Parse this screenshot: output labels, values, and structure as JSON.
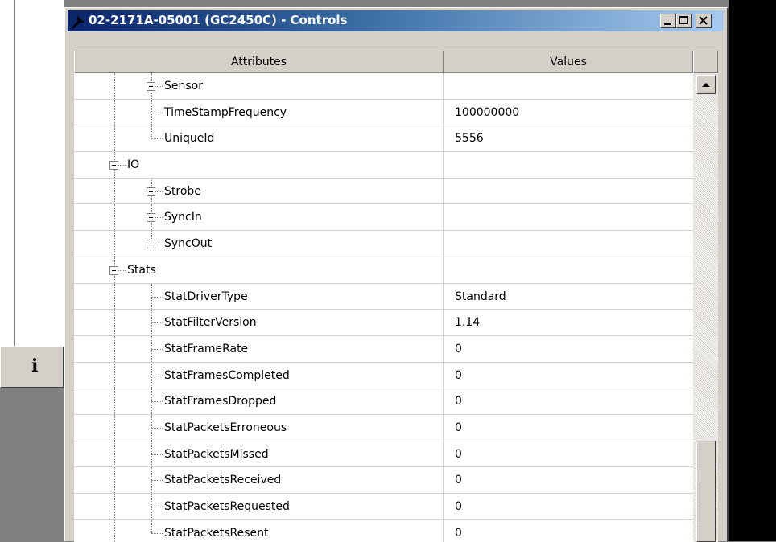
{
  "window": {
    "title": "02-2171A-05001 (GC2450C) - Controls",
    "title_icon": "wrench-icon",
    "buttons": {
      "minimize": "minimize-icon",
      "maximize": "maximize-icon",
      "close": "close-icon"
    }
  },
  "background": {
    "info_button": "i"
  },
  "grid": {
    "columns": [
      "Attributes",
      "Values"
    ],
    "rows": [
      {
        "label": "Sensor",
        "value": "",
        "level": 2,
        "expander": "plus"
      },
      {
        "label": "TimeStampFrequency",
        "value": "100000000",
        "level": 2,
        "expander": ""
      },
      {
        "label": "UniqueId",
        "value": "5556",
        "level": 2,
        "expander": "",
        "last": true
      },
      {
        "label": "IO",
        "value": "",
        "level": 1,
        "expander": "minus"
      },
      {
        "label": "Strobe",
        "value": "",
        "level": 2,
        "expander": "plus"
      },
      {
        "label": "SyncIn",
        "value": "",
        "level": 2,
        "expander": "plus"
      },
      {
        "label": "SyncOut",
        "value": "",
        "level": 2,
        "expander": "plus",
        "last": true
      },
      {
        "label": "Stats",
        "value": "",
        "level": 1,
        "expander": "minus"
      },
      {
        "label": "StatDriverType",
        "value": "Standard",
        "level": 2,
        "expander": ""
      },
      {
        "label": "StatFilterVersion",
        "value": "1.14",
        "level": 2,
        "expander": ""
      },
      {
        "label": "StatFrameRate",
        "value": "0",
        "level": 2,
        "expander": ""
      },
      {
        "label": "StatFramesCompleted",
        "value": "0",
        "level": 2,
        "expander": ""
      },
      {
        "label": "StatFramesDropped",
        "value": "0",
        "level": 2,
        "expander": ""
      },
      {
        "label": "StatPacketsErroneous",
        "value": "0",
        "level": 2,
        "expander": ""
      },
      {
        "label": "StatPacketsMissed",
        "value": "0",
        "level": 2,
        "expander": ""
      },
      {
        "label": "StatPacketsReceived",
        "value": "0",
        "level": 2,
        "expander": ""
      },
      {
        "label": "StatPacketsRequested",
        "value": "0",
        "level": 2,
        "expander": ""
      },
      {
        "label": "StatPacketsResent",
        "value": "0",
        "level": 2,
        "expander": "",
        "last": true
      }
    ]
  },
  "scrollbar": {
    "position": 0.78
  }
}
